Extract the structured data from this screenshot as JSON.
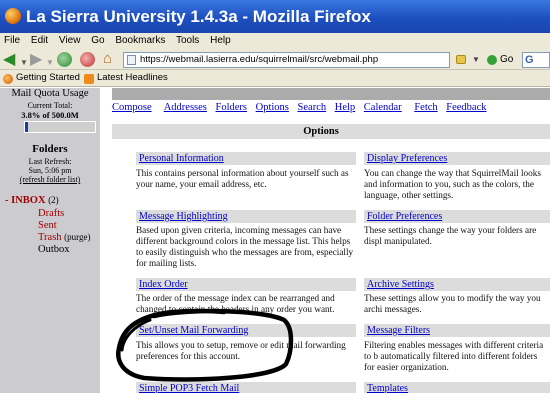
{
  "window": {
    "title": "La Sierra University 1.4.3a - Mozilla Firefox"
  },
  "menu": [
    "File",
    "Edit",
    "View",
    "Go",
    "Bookmarks",
    "Tools",
    "Help"
  ],
  "navbar": {
    "url": "https://webmail.lasierra.edu/squirrelmail/src/webmail.php",
    "go_label": "Go",
    "search_label": "G"
  },
  "bookmarks": [
    "Getting Started",
    "Latest Headlines"
  ],
  "left_pane": {
    "quota_title": "Mail Quota Usage",
    "quota_current": "Current Total:",
    "quota_value": "3.8% of 500.0M",
    "quota_fraction": 0.038,
    "folders_title": "Folders",
    "last_refresh": "Last Refresh:",
    "refresh_time": "Sun, 5:06 pm",
    "refresh_link": "(refresh folder list)",
    "inbox_prefix": "-",
    "inbox_label": "INBOX",
    "inbox_count": "(2)",
    "drafts": "Drafts",
    "sent": "Sent",
    "trash": "Trash",
    "purge": "(purge)",
    "outbox": "Outbox"
  },
  "top_nav": [
    "Compose",
    "Addresses",
    "Folders",
    "Options",
    "Search",
    "Help",
    "Calendar",
    "Fetch",
    "Feedback"
  ],
  "options_header": "Options",
  "sections": {
    "personal_info": {
      "title": "Personal Information",
      "desc": "This contains personal information about yourself such as your name, your email address, etc."
    },
    "display_prefs": {
      "title": "Display Preferences",
      "desc": "You can change the way that SquirrelMail looks and information to you, such as the colors, the language, other settings."
    },
    "msg_highlight": {
      "title": "Message Highlighting",
      "desc": "Based upon given criteria, incoming messages can have different background colors in the message list. This helps to easily distinguish who the messages are from, especially for mailing lists."
    },
    "folder_prefs": {
      "title": "Folder Preferences",
      "desc": "These settings change the way your folders are displ manipulated."
    },
    "index_order": {
      "title": "Index Order",
      "desc": "The order of the message index can be rearranged and changed to contain the headers in any order you want."
    },
    "archive_settings": {
      "title": "Archive Settings",
      "desc": "These settings allow you to modify the way you archi messages."
    },
    "mail_forwarding": {
      "title": "Set/Unset Mail Forwarding",
      "desc": "This allows you to setup, remove or edit mail forwarding preferences for this account."
    },
    "message_filters": {
      "title": "Message Filters",
      "desc": "Filtering enables messages with different criteria to b automatically filtered into different folders for easier organization."
    },
    "pop3_fetch": {
      "title": "Simple POP3 Fetch Mail"
    },
    "templates": {
      "title": "Templates"
    }
  },
  "colors": {
    "link": "#0000cc",
    "folder_red": "#a00000",
    "left_pane_bg": "#ccccd0",
    "section_bg": "#dcdcdc",
    "titlebar": "#1d4fbf"
  },
  "icons": [
    "firefox-icon",
    "back-arrow-icon",
    "forward-arrow-icon",
    "reload-icon",
    "stop-icon",
    "home-icon",
    "page-icon",
    "lock-icon",
    "go-icon",
    "google-search-icon",
    "rss-icon"
  ]
}
